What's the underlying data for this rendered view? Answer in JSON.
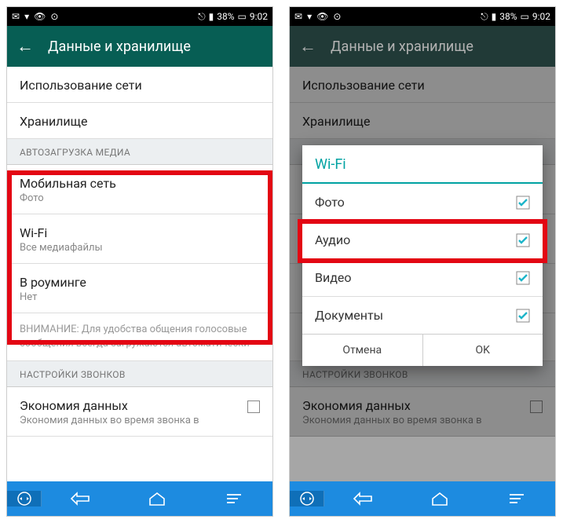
{
  "status": {
    "battery": "38%",
    "time": "9:02"
  },
  "appbar": {
    "title": "Данные и хранилище"
  },
  "rows": {
    "network_usage": "Использование сети",
    "storage": "Хранилище"
  },
  "section_autodownload": "АВТОЗАГРУЗКА МЕДИА",
  "mobile": {
    "label": "Мобильная сеть",
    "sub": "Фото"
  },
  "wifi": {
    "label": "Wi-Fi",
    "sub": "Все медиафайлы"
  },
  "roaming": {
    "label": "В роуминге",
    "sub": "Нет"
  },
  "info": "ВНИМАНИЕ: Для удобства общения голосовые сообщения всегда загружаются автоматически",
  "section_calls": "НАСТРОЙКИ ЗВОНКОВ",
  "economy": {
    "label": "Экономия данных",
    "sub": "Экономия данных во время звонка в"
  },
  "dialog": {
    "title": "Wi-Fi",
    "photo": "Фото",
    "audio": "Аудио",
    "video": "Видео",
    "docs": "Документы",
    "cancel": "Отмена",
    "ok": "OK"
  }
}
